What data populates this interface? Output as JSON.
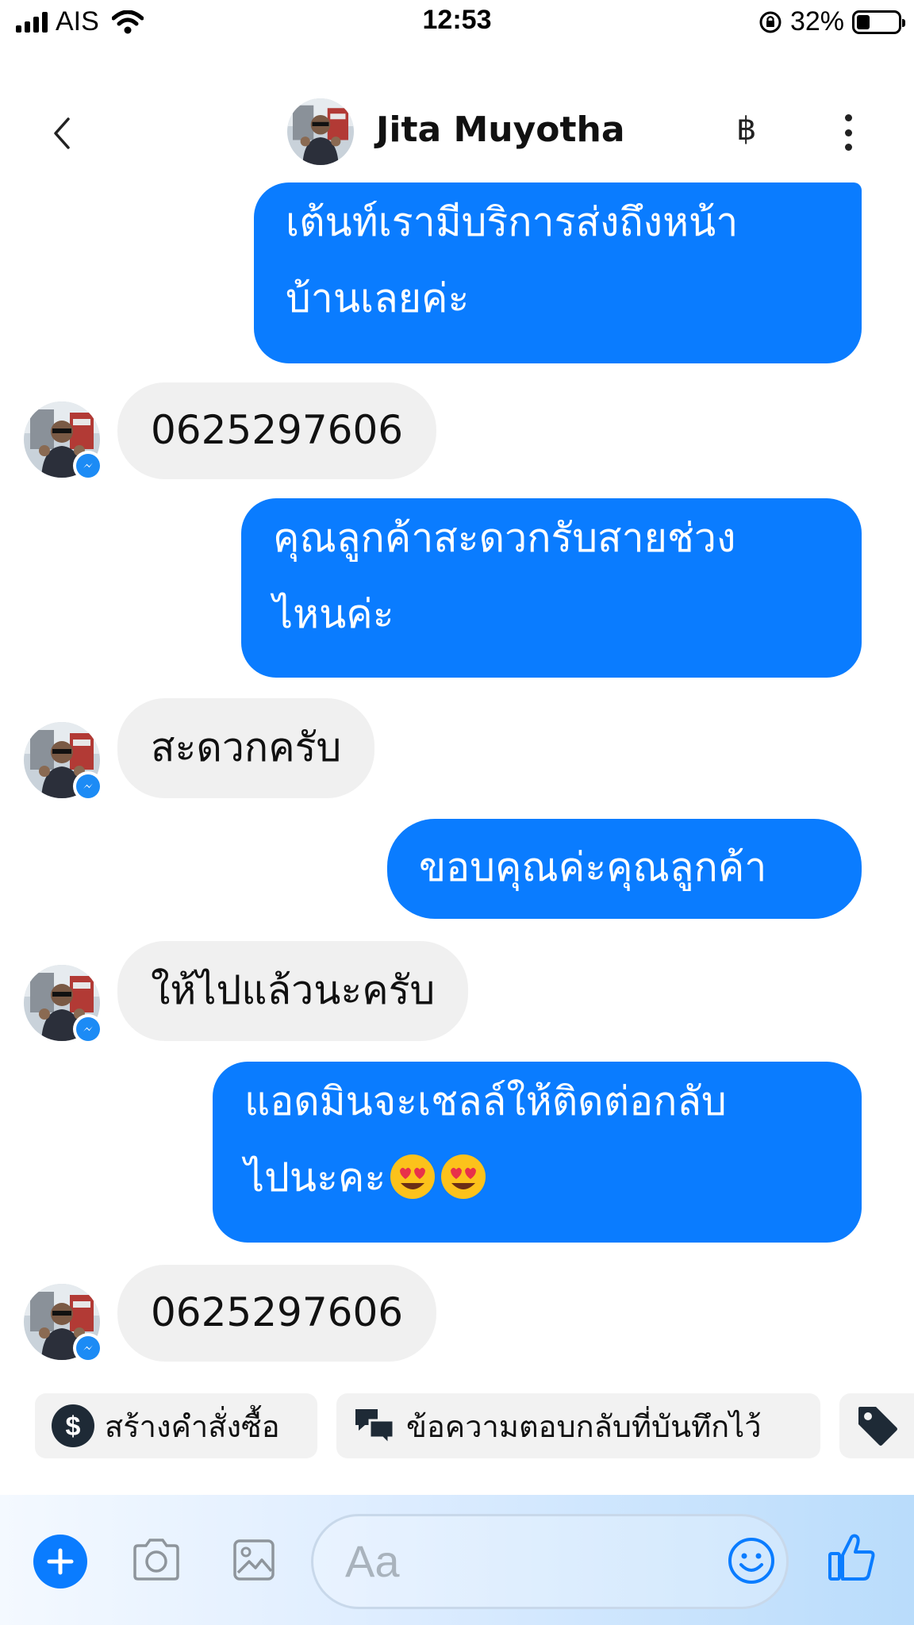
{
  "status_bar": {
    "carrier": "AIS",
    "time": "12:53",
    "battery": "32%",
    "battery_level": 0.32
  },
  "header": {
    "contact_name": "Jita Muyotha",
    "baht_icon": "฿",
    "icons": [
      "back-chevron-icon",
      "baht-icon",
      "more-vertical-icon"
    ]
  },
  "messages": [
    {
      "side": "out",
      "text_line1": "เต้นท์เรามีบริการส่งถึงหน้า",
      "text_line2": "บ้านเลยค่ะ"
    },
    {
      "side": "in",
      "text": "0625297606"
    },
    {
      "side": "out",
      "text_line1": "คุณลูกค้าสะดวกรับสายช่วง",
      "text_line2": "ไหนค่ะ"
    },
    {
      "side": "in",
      "text": "สะดวกครับ"
    },
    {
      "side": "out",
      "text": "ขอบคุณค่ะคุณลูกค้า"
    },
    {
      "side": "in",
      "text": "ให้ไปแล้วนะครับ"
    },
    {
      "side": "out",
      "text_line1": "แอดมินจะเชลล์ให้ติดต่อกลับ",
      "text_line2": "ไปนะคะ",
      "emoji": [
        "heart-eyes-emoji",
        "heart-eyes-emoji"
      ]
    },
    {
      "side": "in",
      "text": "0625297606"
    }
  ],
  "chips": [
    {
      "label": "สร้างคำสั่งซื้อ",
      "icon": "dollar-circle-icon"
    },
    {
      "label": "ข้อความตอบกลับที่บันทึกไว้",
      "icon": "chat-bubbles-icon"
    },
    {
      "label": "",
      "icon": "tag-icon"
    }
  ],
  "composer": {
    "placeholder": "Aa",
    "icons": [
      "plus-icon",
      "camera-icon",
      "image-icon",
      "emoji-icon",
      "thumbs-up-icon"
    ]
  },
  "colors": {
    "outgoing_bubble": "#0a7cff",
    "incoming_bubble": "#f0f0f0",
    "accent": "#0a7cff"
  }
}
